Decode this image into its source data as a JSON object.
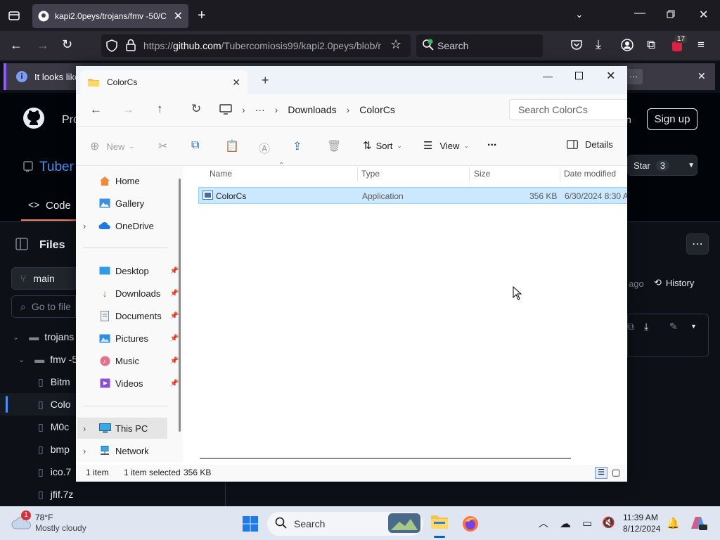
{
  "browser": {
    "tab_title": "kapi2.0peys/trojans/fmv -50/C",
    "url_prefix": "https://",
    "url_host": "github.com",
    "url_path": "/Tubercomiosis99/kapi2.0peys/blob/r",
    "search_placeholder": "Search",
    "extension_badge": "17",
    "notification_text": "It looks like"
  },
  "github": {
    "header_prefix": "Pro",
    "header_right": "n",
    "signup_label": "Sign up",
    "repo_owner_partial": "Tuber",
    "code_tab": "Code",
    "star_label": "Star",
    "star_count": "3",
    "files_label": "Files",
    "branch": "main",
    "goto_placeholder": "Go to file",
    "ago_text": "ago",
    "history_label": "History",
    "tree": [
      {
        "label": "trojans"
      },
      {
        "label": "fmv -5"
      },
      {
        "label": "Bitm"
      },
      {
        "label": "Colo"
      },
      {
        "label": "M0c"
      },
      {
        "label": "bmp"
      },
      {
        "label": "ico.7"
      },
      {
        "label": "jfif.7z"
      }
    ]
  },
  "explorer": {
    "tab_title": "ColorCs",
    "breadcrumb": [
      "Downloads",
      "ColorCs"
    ],
    "search_placeholder": "Search ColorCs",
    "toolbar": {
      "new": "New",
      "sort": "Sort",
      "view": "View",
      "more": "...",
      "details": "Details"
    },
    "nav": {
      "home": "Home",
      "gallery": "Gallery",
      "onedrive": "OneDrive",
      "desktop": "Desktop",
      "downloads": "Downloads",
      "documents": "Documents",
      "pictures": "Pictures",
      "music": "Music",
      "videos": "Videos",
      "thispc": "This PC",
      "network": "Network"
    },
    "columns": {
      "name": "Name",
      "type": "Type",
      "size": "Size",
      "date": "Date modified"
    },
    "file": {
      "name": "ColorCs",
      "type": "Application",
      "size": "356 KB",
      "date": "6/30/2024 8:30 AM"
    },
    "status": {
      "count": "1 item",
      "selected": "1 item selected",
      "size": "356 KB"
    }
  },
  "taskbar": {
    "weather_temp": "78°F",
    "weather_desc": "Mostly cloudy",
    "weather_badge": "1",
    "search_label": "Search",
    "time": "11:39 AM",
    "date": "8/12/2024"
  },
  "colors": {
    "firefox_dark": "#1c1b22",
    "selection": "#cce8ff",
    "github_bg": "#0d1117",
    "taskbar": "#dfe6f2"
  }
}
